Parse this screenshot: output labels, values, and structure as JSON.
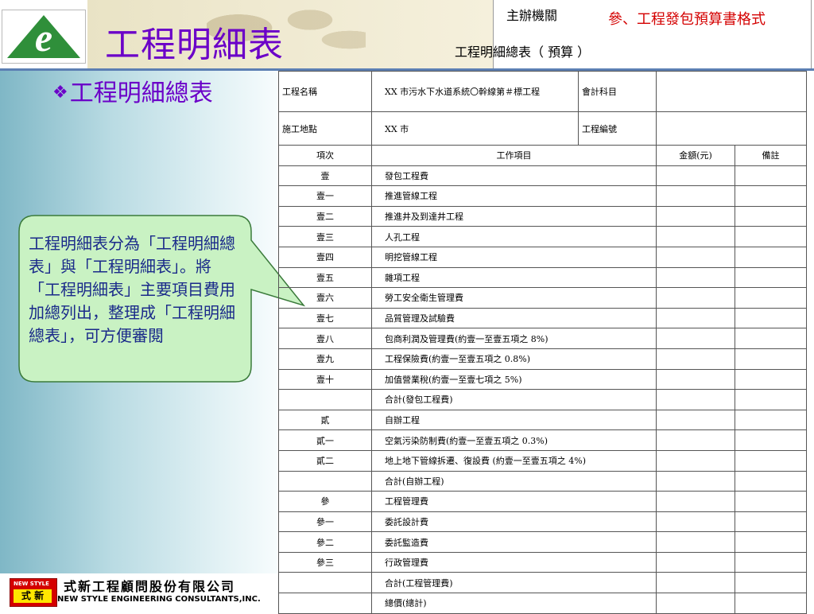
{
  "header": {
    "title": "工程明細表",
    "host_label": "主辦機關",
    "format_label": "參、工程發包預算書格式",
    "sheet_title": "工程明細總表（ 預算 ）"
  },
  "left": {
    "bullet_title": "工程明細總表",
    "callout_text": "工程明細表分為「工程明細總表」與「工程明細表」。將「工程明細表」主要項目費用加總列出，整理成「工程明細總表」，可方便審閱"
  },
  "footer": {
    "logo_top": "NEW STYLE",
    "logo_bottom": "式 新",
    "company_cn": "式新工程顧問股份有限公司",
    "company_en": "NEW  STYLE ENGINEERING CONSULTANTS,INC."
  },
  "table": {
    "project_name_label": "工程名稱",
    "project_name_value": "XX 市污水下水道系統〇幹線第＃標工程",
    "accounting_label": "會計科目",
    "accounting_value": "",
    "site_label": "施工地點",
    "site_value": "XX 市",
    "code_label": "工程編號",
    "code_value": "",
    "col_item_no": "項次",
    "col_work_item": "工作項目",
    "col_amount": "金額(元)",
    "col_remark": "備註",
    "rows": [
      {
        "no": "壹",
        "item": "發包工程費",
        "amount": "",
        "remark": ""
      },
      {
        "no": "壹一",
        "item": "推進管線工程",
        "amount": "",
        "remark": ""
      },
      {
        "no": "壹二",
        "item": "推進井及到達井工程",
        "amount": "",
        "remark": ""
      },
      {
        "no": "壹三",
        "item": "人孔工程",
        "amount": "",
        "remark": ""
      },
      {
        "no": "壹四",
        "item": "明挖管線工程",
        "amount": "",
        "remark": ""
      },
      {
        "no": "壹五",
        "item": "雜項工程",
        "amount": "",
        "remark": ""
      },
      {
        "no": "壹六",
        "item": "勞工安全衛生管理費",
        "amount": "",
        "remark": ""
      },
      {
        "no": "壹七",
        "item": "品質管理及試驗費",
        "amount": "",
        "remark": ""
      },
      {
        "no": "壹八",
        "item": "包商利潤及管理費(約壹一至壹五項之 8%)",
        "amount": "",
        "remark": ""
      },
      {
        "no": "壹九",
        "item": "工程保險費(約壹一至壹五項之 0.8%)",
        "amount": "",
        "remark": ""
      },
      {
        "no": "壹十",
        "item": "加值營業稅(約壹一至壹七項之 5%)",
        "amount": "",
        "remark": ""
      },
      {
        "no": "",
        "item": "合計(發包工程費)",
        "amount": "",
        "remark": ""
      },
      {
        "no": "貳",
        "item": "自辦工程",
        "amount": "",
        "remark": ""
      },
      {
        "no": "貳一",
        "item": "空氣污染防制費(約壹一至壹五項之 0.3%)",
        "amount": "",
        "remark": ""
      },
      {
        "no": "貳二",
        "item": "地上地下管線拆遷、復設費 (約壹一至壹五項之 4%)",
        "amount": "",
        "remark": ""
      },
      {
        "no": "",
        "item": "合計(自辦工程)",
        "amount": "",
        "remark": ""
      },
      {
        "no": "參",
        "item": "工程管理費",
        "amount": "",
        "remark": ""
      },
      {
        "no": "參一",
        "item": "委託設計費",
        "amount": "",
        "remark": ""
      },
      {
        "no": "參二",
        "item": "委託監造費",
        "amount": "",
        "remark": ""
      },
      {
        "no": "參三",
        "item": "行政管理費",
        "amount": "",
        "remark": ""
      },
      {
        "no": "",
        "item": "合計(工程管理費)",
        "amount": "",
        "remark": ""
      },
      {
        "no": "",
        "item": "總價(總計)",
        "amount": "",
        "remark": ""
      }
    ]
  }
}
